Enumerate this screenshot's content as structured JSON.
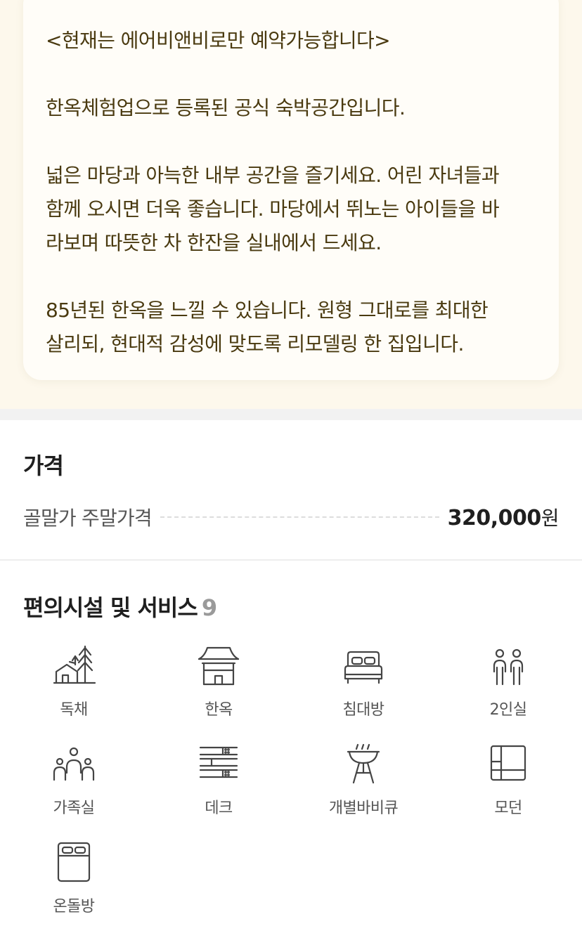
{
  "description": {
    "paragraphs": [
      "<현재는 에어비앤비로만 예약가능합니다>",
      "한옥체험업으로 등록된 공식 숙박공간입니다.",
      "넓은 마당과 아늑한 내부 공간을 즐기세요. 어린 자녀들과\n함께 오시면 더욱 좋습니다. 마당에서 뛰노는 아이들을 바\n라보며 따뜻한 차 한잔을 실내에서 드세요.",
      "85년된 한옥을 느낄 수 있습니다. 원형 그대로를 최대한\n살리되, 현대적 감성에 맞도록 리모델링 한 집입니다."
    ]
  },
  "price": {
    "title": "가격",
    "label": "골말가 주말가격",
    "value": "320,000",
    "unit": "원"
  },
  "amenities": {
    "title": "편의시설 및 서비스",
    "count": "9",
    "items": [
      {
        "label": "독채",
        "icon": "house-trees-icon"
      },
      {
        "label": "한옥",
        "icon": "hanok-icon"
      },
      {
        "label": "침대방",
        "icon": "bed-icon"
      },
      {
        "label": "2인실",
        "icon": "two-people-icon"
      },
      {
        "label": "가족실",
        "icon": "family-icon"
      },
      {
        "label": "데크",
        "icon": "deck-icon"
      },
      {
        "label": "개별바비큐",
        "icon": "barbecue-grill-icon"
      },
      {
        "label": "모던",
        "icon": "modern-window-icon"
      },
      {
        "label": "온돌방",
        "icon": "ondol-floor-icon"
      }
    ]
  },
  "colors": {
    "top_background": "#fdf8ec",
    "card_background": "#fffdf8",
    "description_text": "#4a3a10",
    "icon_stroke": "#444444"
  }
}
